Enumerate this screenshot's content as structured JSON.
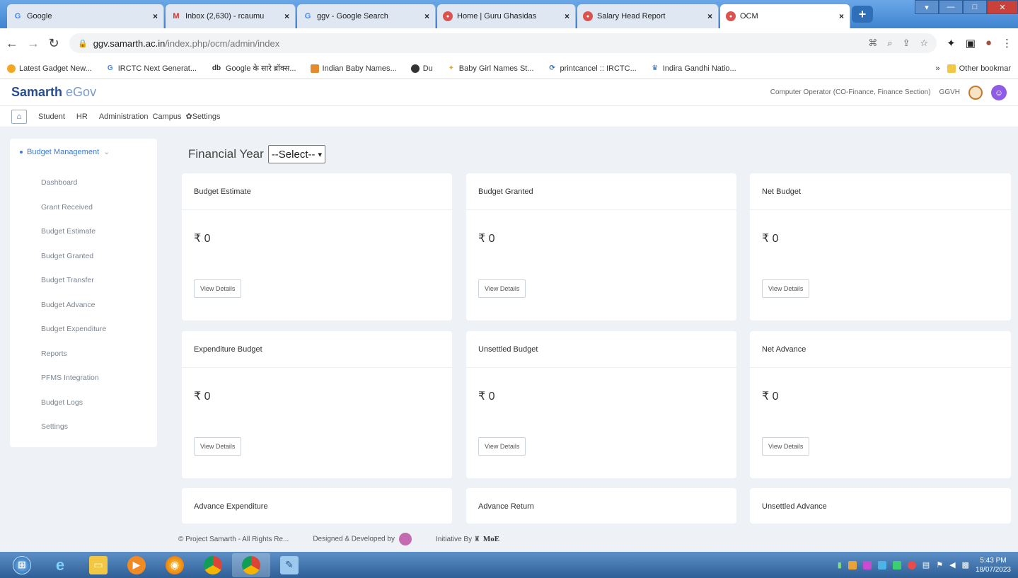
{
  "browser": {
    "tabs": [
      {
        "title": "Google",
        "icon": "G",
        "color": "#4285f4"
      },
      {
        "title": "Inbox (2,630) - rcaumu",
        "icon": "M",
        "color": "#d93025"
      },
      {
        "title": "ggv - Google Search",
        "icon": "G",
        "color": "#4285f4"
      },
      {
        "title": "Home | Guru Ghasidas",
        "icon": "●",
        "color": "#d9534f"
      },
      {
        "title": "Salary Head Report",
        "icon": "●",
        "color": "#d9534f"
      },
      {
        "title": "OCM",
        "icon": "●",
        "color": "#d9534f"
      }
    ],
    "new_tab": "+",
    "url_host": "ggv.samarth.ac.in",
    "url_path": "/index.php/ocm/admin/index",
    "bookmarks": [
      "Latest Gadget New...",
      "IRCTC Next Generat...",
      "Google के सारे ब्रॉक्स...",
      "Indian Baby Names...",
      "Du",
      "Baby Girl Names St...",
      "printcancel :: IRCTC...",
      "Indira Gandhi Natio..."
    ],
    "bookmark_icons": [
      "sun-icon",
      "G",
      "db",
      "baby-icon",
      "globe-icon",
      "star-icon",
      "irctc-icon",
      "ignou-icon"
    ],
    "more_bookmarks": "»",
    "other_bookmarks": "Other bookmar"
  },
  "app": {
    "brand_bold": "Samarth",
    "brand_light": "eGov",
    "user_role": "Computer Operator (CO-Finance, Finance Section)",
    "university": "GGVH",
    "nav": [
      "Student",
      "HR",
      "Administration",
      "Campus",
      "Settings"
    ]
  },
  "sidebar": {
    "header": "Budget Management",
    "items": [
      "Dashboard",
      "Grant Received",
      "Budget Estimate",
      "Budget Granted",
      "Budget Transfer",
      "Budget Advance",
      "Budget Expenditure",
      "Reports",
      "PFMS Integration",
      "Budget Logs",
      "Settings"
    ]
  },
  "filter": {
    "label": "Financial Year",
    "selected": "--Select--"
  },
  "cards": [
    {
      "title": "Budget Estimate",
      "value": "₹ 0",
      "button": "View Details"
    },
    {
      "title": "Budget Granted",
      "value": "₹ 0",
      "button": "View Details"
    },
    {
      "title": "Net Budget",
      "value": "₹ 0",
      "button": "View Details"
    },
    {
      "title": "Expenditure Budget",
      "value": "₹ 0",
      "button": "View Details"
    },
    {
      "title": "Unsettled Budget",
      "value": "₹ 0",
      "button": "View Details"
    },
    {
      "title": "Net Advance",
      "value": "₹ 0",
      "button": "View Details"
    },
    {
      "title": "Advance Expenditure"
    },
    {
      "title": "Advance Return"
    },
    {
      "title": "Unsettled Advance"
    }
  ],
  "footer": {
    "copyright": "© Project Samarth - All Rights Re...",
    "designed_by": "Designed & Developed by",
    "initiative_by": "Initiative By",
    "moe": "MoE"
  },
  "taskbar": {
    "time": "5:43 PM",
    "date": "18/07/2023"
  }
}
